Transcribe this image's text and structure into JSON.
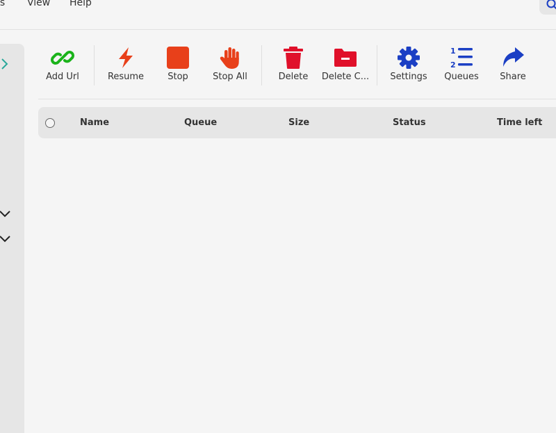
{
  "menu": {
    "items": [
      {
        "id": "tools",
        "label": "ls"
      },
      {
        "id": "view",
        "label": "View"
      },
      {
        "id": "help",
        "label": "Help"
      }
    ]
  },
  "toolbar": {
    "add_url": "Add Url",
    "resume": "Resume",
    "stop": "Stop",
    "stop_all": "Stop All",
    "delete": "Delete",
    "delete_completed": "Delete C...",
    "settings": "Settings",
    "queues": "Queues",
    "share": "Share"
  },
  "table": {
    "columns": [
      "Name",
      "Queue",
      "Size",
      "Status",
      "Time left"
    ],
    "rows": []
  },
  "colors": {
    "add_url": "#1bb31b",
    "resume": "#e8401a",
    "stop": "#e8401a",
    "delete": "#e0102a",
    "settings": "#1b3fc4",
    "sidebar_chevron": "#2aa89a"
  }
}
